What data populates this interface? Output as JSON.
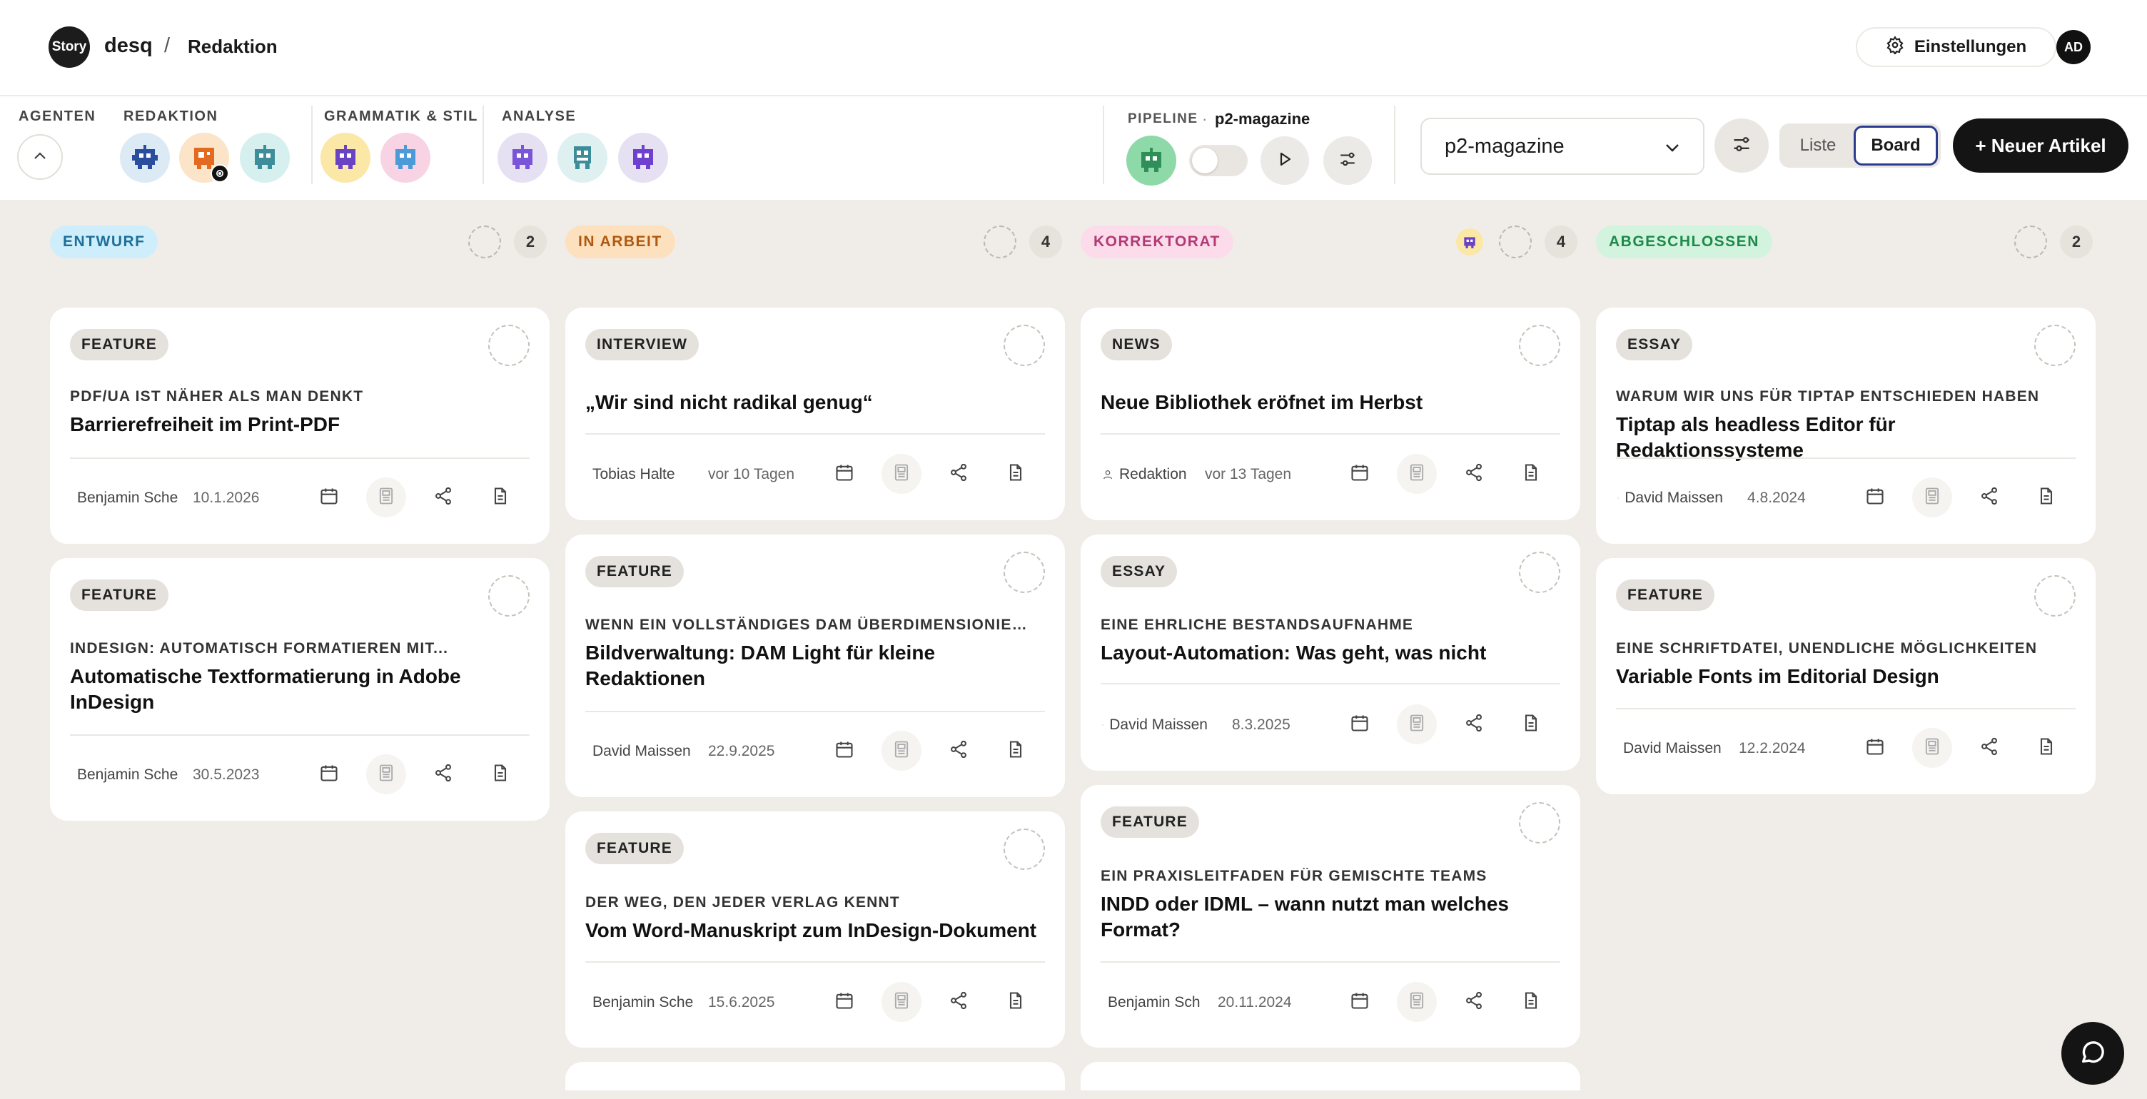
{
  "header": {
    "logo_text": "Story",
    "brand": "desq",
    "separator": "/",
    "breadcrumb": "Redaktion",
    "settings_label": "Einstellungen",
    "user_initials": "AD"
  },
  "agents": {
    "groups": [
      {
        "label": "AGENTEN"
      },
      {
        "label": "REDAKTION"
      },
      {
        "label": "GRAMMATIK & STIL"
      },
      {
        "label": "ANALYSE"
      }
    ]
  },
  "pipeline": {
    "label": "PIPELINE",
    "dot": "·",
    "name": "p2-magazine",
    "enabled": false
  },
  "toolbar": {
    "publication": "p2-magazine",
    "view_list": "Liste",
    "view_board": "Board",
    "new_article": "+ Neuer Artikel"
  },
  "colors": {
    "entwurf_bg": "#cfeefb",
    "entwurf_fg": "#1d6f9a",
    "inarbeit_bg": "#fde0bd",
    "inarbeit_fg": "#b0580f",
    "korrektorat_bg": "#fcdcea",
    "korrektorat_fg": "#b23a74",
    "abgeschlossen_bg": "#d2f3dd",
    "abgeschlossen_fg": "#1d8a4a"
  },
  "columns": [
    {
      "status": "ENTWURF",
      "count": "2"
    },
    {
      "status": "IN ARBEIT",
      "count": "4"
    },
    {
      "status": "KORREKTORAT",
      "count": "4"
    },
    {
      "status": "ABGESCHLOSSEN",
      "count": "2"
    }
  ],
  "cards": {
    "c0_0": {
      "type": "FEATURE",
      "kicker": "PDF/UA IST NÄHER ALS MAN DENKT",
      "title": "Barrierefreiheit im Print-PDF",
      "author": "Benjamin Sche",
      "date": "10.1.2026"
    },
    "c0_1": {
      "type": "FEATURE",
      "kicker": "INDESIGN: AUTOMATISCH FORMATIEREN MIT...",
      "title": "Automatische Textformatierung in Adobe InDesign",
      "author": "Benjamin Sche",
      "date": "30.5.2023"
    },
    "c1_0": {
      "type": "INTERVIEW",
      "kicker": "",
      "title": "„Wir sind nicht radikal genug“",
      "author": "Tobias Halte",
      "date": "vor 10 Tagen"
    },
    "c1_1": {
      "type": "FEATURE",
      "kicker": "WENN EIN VOLLSTÄNDIGES DAM ÜBERDIMENSIONIER...",
      "title": "Bildverwaltung: DAM Light für kleine Redaktionen",
      "author": "David Maissen",
      "date": "22.9.2025"
    },
    "c1_2": {
      "type": "FEATURE",
      "kicker": "DER WEG, DEN JEDER VERLAG KENNT",
      "title": "Vom Word-Manuskript zum InDesign-Dokument",
      "author": "Benjamin Sche",
      "date": "15.6.2025"
    },
    "c2_0": {
      "type": "NEWS",
      "kicker": "",
      "title": "Neue Bibliothek eröfnet im Herbst",
      "author": "Redaktion",
      "date": "vor 13 Tagen"
    },
    "c2_1": {
      "type": "ESSAY",
      "kicker": "EINE EHRLICHE BESTANDSAUFNAHME",
      "title": "Layout-Automation: Was geht, was nicht",
      "author": "David Maissen",
      "date": "8.3.2025"
    },
    "c2_2": {
      "type": "FEATURE",
      "kicker": "EIN PRAXISLEITFADEN FÜR GEMISCHTE TEAMS",
      "title": "INDD oder IDML – wann nutzt man welches Format?",
      "author": "Benjamin Sch",
      "date": "20.11.2024"
    },
    "c3_0": {
      "type": "ESSAY",
      "kicker": "WARUM WIR UNS FÜR TIPTAP ENTSCHIEDEN HABEN",
      "title": "Tiptap als headless Editor für Redaktionssysteme",
      "author": "David Maissen",
      "date": "4.8.2024"
    },
    "c3_1": {
      "type": "FEATURE",
      "kicker": "EINE SCHRIFTDATEI, UNENDLICHE MÖGLICHKEITEN",
      "title": "Variable Fonts im Editorial Design",
      "author": "David Maissen",
      "date": "12.2.2024"
    }
  },
  "icons": {
    "settings": "gear-icon",
    "chevron": "chevron-down-icon",
    "filter": "sliders-icon",
    "calendar": "calendar-icon",
    "print": "newspaper-icon",
    "share": "share-icon",
    "document": "document-icon",
    "chat": "chat-icon",
    "play": "play-icon"
  }
}
